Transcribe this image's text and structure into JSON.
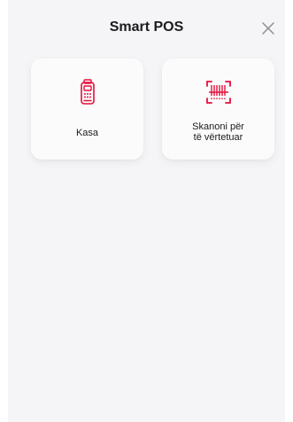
{
  "header": {
    "title": "Smart POS",
    "close_icon": "close-icon"
  },
  "actions": [
    {
      "label": "Kasa",
      "icon": "pos-terminal-icon"
    },
    {
      "label_line1": "Skanoni për",
      "label_line2": "të vërtetuar",
      "icon": "barcode-scan-icon"
    }
  ],
  "colors": {
    "accent": "#e3103a",
    "background": "#f5f5f7",
    "card": "#fbfbfc",
    "text": "#1b1b1f"
  }
}
